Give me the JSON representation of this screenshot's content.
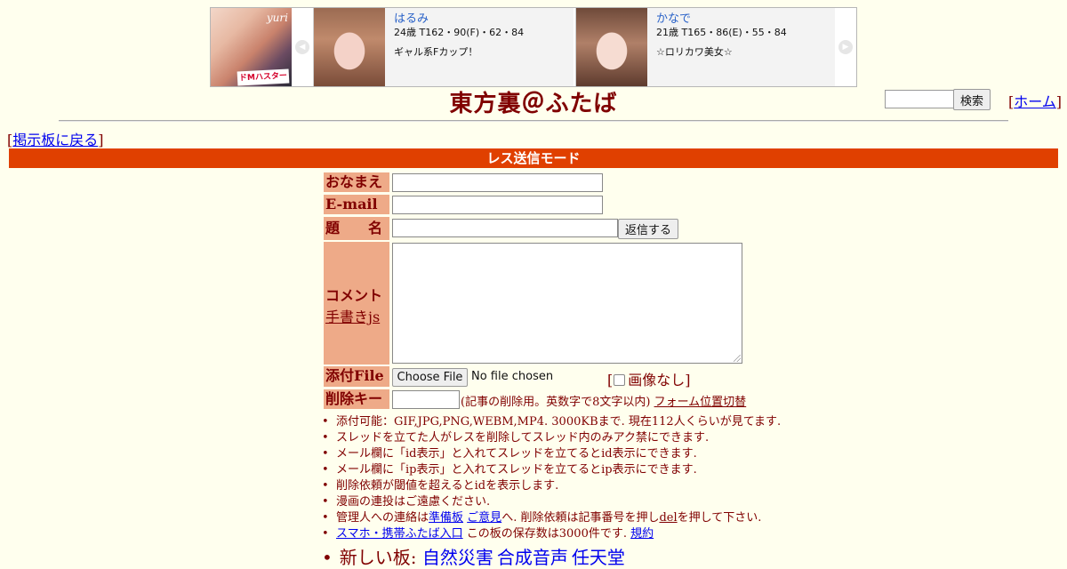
{
  "banner": {
    "ad_brand": "yuri",
    "ad_tag": "ドMハスターズ!!",
    "cards": [
      {
        "name": "はるみ",
        "spec": "24歳 T162・90(F)・62・84",
        "desc": "ギャル系Fカップ！"
      },
      {
        "name": "かなで",
        "spec": "21歳 T165・86(E)・55・84",
        "desc": "☆ロリカワ美女☆"
      }
    ],
    "prev_icon": "◀",
    "next_icon": "▶"
  },
  "header": {
    "title": "東方裏＠ふたば",
    "search_button": "検索",
    "home_link": "ホーム",
    "back_link": "掲示板に戻る",
    "bracket_open": "[",
    "bracket_close": "]"
  },
  "mode": "レス送信モード",
  "form": {
    "name_label": "おなまえ",
    "email_label": "E-mail",
    "subject_label": "題　名",
    "reply_button": "返信する",
    "comment_label": "コメント",
    "tegaki_link": "手書きjs",
    "file_label": "添付File",
    "file_button": "Choose File",
    "file_status": "No file chosen",
    "no_image_label": "画像なし",
    "delkey_label": "削除キー",
    "delkey_note": "(記事の削除用。英数字で8文字以内)",
    "form_toggle_link": "フォーム位置切替"
  },
  "notes": {
    "n1": "添付可能：GIF,JPG,PNG,WEBM,MP4. 3000KBまで. 現在112人くらいが見てます.",
    "n2": "スレッドを立てた人がレスを削除してスレッド内のみアク禁にできます.",
    "n3": "メール欄に「id表示」と入れてスレッドを立てるとid表示にできます.",
    "n4": "メール欄に「ip表示」と入れてスレッドを立てるとip表示にできます.",
    "n5": "削除依頼が閾値を超えるとidを表示します.",
    "n6": "漫画の連投はご遠慮ください.",
    "n7_pre": "管理人への連絡は",
    "n7_link1": "準備板",
    "n7_link2": "ご意見",
    "n7_mid": "へ. 削除依頼は記事番号を押し",
    "n7_del": "del",
    "n7_post": "を押して下さい.",
    "n8_link": "スマホ・携帯ふたば入口",
    "n8_mid": "この板の保存数は3000件です.",
    "n8_rules": "規約",
    "new_boards_label": "新しい板:",
    "new_boards": [
      "自然災害",
      "合成音声",
      "任天堂"
    ]
  }
}
